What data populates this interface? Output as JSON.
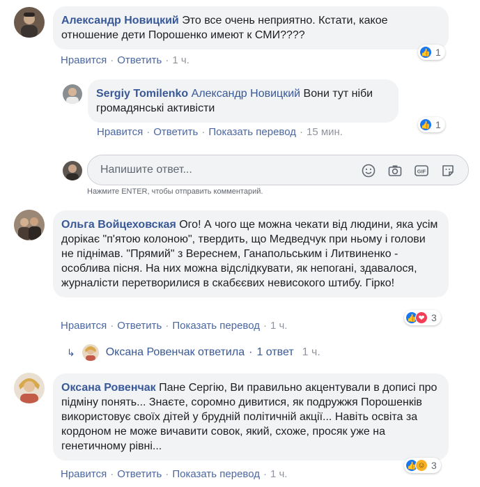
{
  "comments": [
    {
      "author": "Александр Новицкий",
      "text": "Это все очень неприятно. Кстати, какое отношение дети Порошенко имеют к СМИ????",
      "like_label": "Нравится",
      "reply_label": "Ответить",
      "time": "1 ч.",
      "reaction_count": "1"
    },
    {
      "author": "Sergiy Tomilenko",
      "mention": "Александр Новицкий",
      "text": "Вони тут ніби громадянські активісти",
      "like_label": "Нравится",
      "reply_label": "Ответить",
      "translate_label": "Показать перевод",
      "time": "15 мин.",
      "reaction_count": "1"
    },
    {
      "author": "Ольга Войцеховская",
      "text": "Ого! А чого ще можна чекати від людини, яка усім дорікає \"п'ятою колоною\", твердить, що Медведчук при ньому і голови не піднімав. \"Прямий\" з Вереснем, Ганапольським і Литвиненко - особлива пісня. На них можна відслідкувати, як непогані, здавалося, журналісти перетворилися в скабєєвих невисокого штибу. Гірко!",
      "like_label": "Нравится",
      "reply_label": "Ответить",
      "translate_label": "Показать перевод",
      "time": "1 ч.",
      "reaction_count": "3"
    },
    {
      "author": "Оксана Ровенчак",
      "text": "Пане Сергію, Ви правильно акцентували в дописі про підміну понять... Знаєте, соромно дивитися, як подружжя Порошенків використовує своїх дітей у брудній політичній акції... Навіть освіта за кордоном не може вичавити совок, який, схоже, просяк уже на генетичному рівні...",
      "like_label": "Нравится",
      "reply_label": "Ответить",
      "translate_label": "Показать перевод",
      "time": "1 ч.",
      "reaction_count": "3"
    }
  ],
  "reply_box": {
    "placeholder": "Напишите ответ...",
    "hint": "Нажмите ENTER, чтобы отправить комментарий.",
    "tools": [
      "emoji-icon",
      "camera-icon",
      "gif-icon",
      "sticker-icon"
    ]
  },
  "replies_summary": {
    "text": "Оксана Ровенчак ответила",
    "count": "1 ответ",
    "time": "1 ч."
  },
  "colors": {
    "link": "#385898",
    "action_link": "#4b67a1",
    "bubble_bg": "#f2f3f5",
    "like_blue": "#1877f2",
    "love_red": "#f33e58",
    "haha_yellow": "#f7b125"
  }
}
